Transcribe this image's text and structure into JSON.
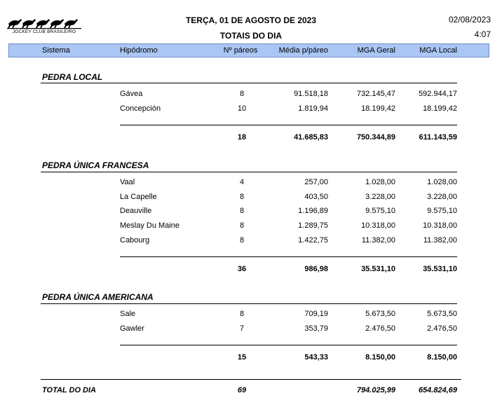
{
  "header": {
    "logo_text": "JOCKEY CLUB BRASILEIRO",
    "title": "TERÇA, 01 DE AGOSTO DE 2023",
    "subtitle": "TOTAIS DO DIA",
    "date": "02/08/2023",
    "time": "4:07"
  },
  "columns": [
    "Sistema",
    "Hipódromo",
    "Nº páreos",
    "Média p/páreo",
    "MGA  Geral",
    "MGA Local"
  ],
  "sections": [
    {
      "name": "PEDRA LOCAL",
      "rows": [
        {
          "hip": "Gávea",
          "pareos": "8",
          "media": "91.518,18",
          "geral": "732.145,47",
          "local": "592.944,17"
        },
        {
          "hip": "Concepción",
          "pareos": "10",
          "media": "1.819,94",
          "geral": "18.199,42",
          "local": "18.199,42"
        }
      ],
      "total": {
        "pareos": "18",
        "media": "41.685,83",
        "geral": "750.344,89",
        "local": "611.143,59"
      }
    },
    {
      "name": "PEDRA ÚNICA FRANCESA",
      "rows": [
        {
          "hip": "Vaal",
          "pareos": "4",
          "media": "257,00",
          "geral": "1.028,00",
          "local": "1.028,00"
        },
        {
          "hip": "La Capelle",
          "pareos": "8",
          "media": "403,50",
          "geral": "3.228,00",
          "local": "3.228,00"
        },
        {
          "hip": "Deauville",
          "pareos": "8",
          "media": "1.196,89",
          "geral": "9.575,10",
          "local": "9.575,10"
        },
        {
          "hip": "Meslay Du Maine",
          "pareos": "8",
          "media": "1.289,75",
          "geral": "10.318,00",
          "local": "10.318,00"
        },
        {
          "hip": "Cabourg",
          "pareos": "8",
          "media": "1.422,75",
          "geral": "11.382,00",
          "local": "11.382,00"
        }
      ],
      "total": {
        "pareos": "36",
        "media": "986,98",
        "geral": "35.531,10",
        "local": "35.531,10"
      }
    },
    {
      "name": "PEDRA ÚNICA AMERICANA",
      "rows": [
        {
          "hip": "Sale",
          "pareos": "8",
          "media": "709,19",
          "geral": "5.673,50",
          "local": "5.673,50"
        },
        {
          "hip": "Gawler",
          "pareos": "7",
          "media": "353,79",
          "geral": "2.476,50",
          "local": "2.476,50"
        }
      ],
      "total": {
        "pareos": "15",
        "media": "543,33",
        "geral": "8.150,00",
        "local": "8.150,00"
      }
    }
  ],
  "grand_total": {
    "label": "TOTAL DO DIA",
    "pareos": "69",
    "geral": "794.025,99",
    "local": "654.824,69"
  }
}
